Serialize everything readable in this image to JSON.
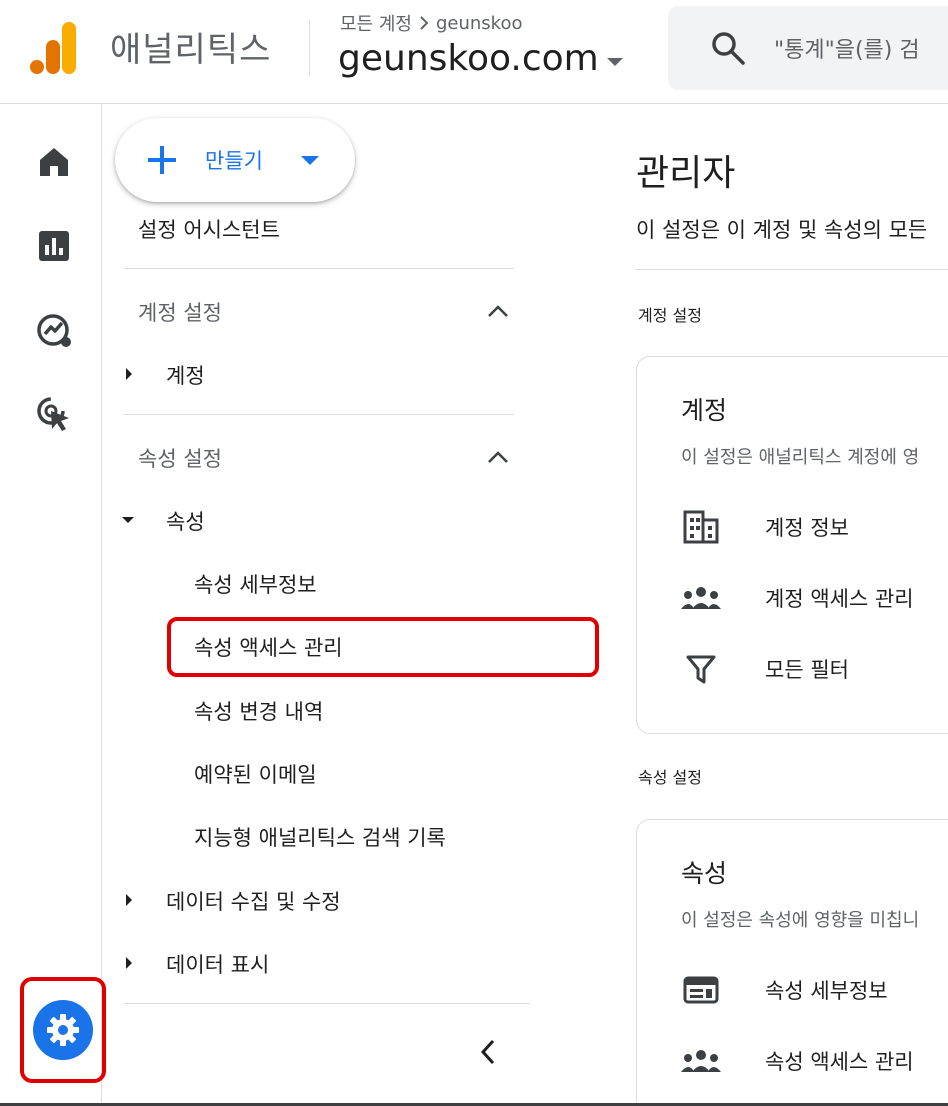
{
  "header": {
    "app_name": "애널리틱스",
    "breadcrumb_all": "모든 계정",
    "breadcrumb_account": "geunskoo",
    "property_name": "geunskoo.com",
    "search_placeholder": "\"통계\"을(를) 검"
  },
  "rail": {
    "icons": [
      "home-icon",
      "reports-icon",
      "explore-icon",
      "advertising-icon",
      "gear-icon"
    ]
  },
  "nav": {
    "create_label": "만들기",
    "setup_assistant": "설정 어시스턴트",
    "account_settings_header": "계정 설정",
    "account_item": "계정",
    "property_settings_header": "속성 설정",
    "property_item": "속성",
    "property_sub": [
      "속성 세부정보",
      "속성 액세스 관리",
      "속성 변경 내역",
      "예약된 이메일",
      "지능형 애널리틱스 검색 기록"
    ],
    "data_collection": "데이터 수집 및 수정",
    "data_display": "데이터 표시"
  },
  "main": {
    "title": "관리자",
    "description": "이 설정은 이 계정 및 속성의 모든",
    "account_section_label": "계정 설정",
    "account_card": {
      "title": "계정",
      "description": "이 설정은 애널리틱스 계정에 영",
      "rows": [
        "계정 정보",
        "계정 액세스 관리",
        "모든 필터"
      ]
    },
    "property_section_label": "속성 설정",
    "property_card": {
      "title": "속성",
      "description": "이 설정은 속성에 영향을 미칩니",
      "rows": [
        "속성 세부정보",
        "속성 액세스 관리"
      ]
    }
  },
  "colors": {
    "accent": "#1a73e8",
    "highlight": "#e00000",
    "logo_orange": "#f9ab00",
    "logo_dark_orange": "#e37400"
  }
}
